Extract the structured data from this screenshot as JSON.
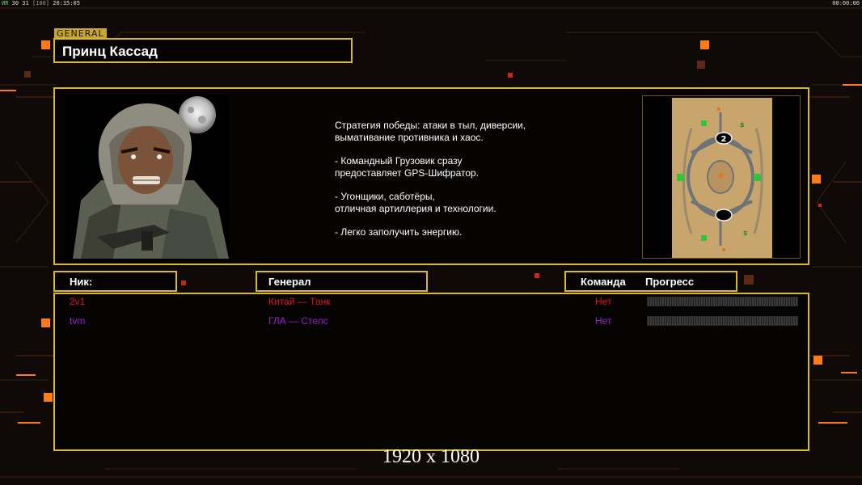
{
  "topbar": {
    "left_a": "ИR",
    "left_b": "30 31",
    "left_c": "[100]",
    "left_time": "20:35:05",
    "right_time": "00:00:00"
  },
  "general": {
    "tag": "GENERAL",
    "name": "Принц Кассад"
  },
  "description": {
    "p1": "Стратегия победы: атаки в тыл, диверсии,\n вымативание противника и хаос.",
    "p2": "- Командный Грузовик сразу\nпредоставляет GPS-Шифратор.",
    "p3": "- Угонщики, саботёры,\nотличная артиллерия и технологии.",
    "p4": "- Легко заполучить энергию."
  },
  "map": {
    "marker_2": "2",
    "supply_label": "$"
  },
  "columns": {
    "nick": "Ник:",
    "general": "Генерал",
    "team": "Команда",
    "progress": "Прогресс"
  },
  "players": [
    {
      "nick": "2v1",
      "general": "Китай — Танк",
      "team": "Нет",
      "color": "#e0141e"
    },
    {
      "nick": "tvm",
      "general": "ГЛА — Стелс",
      "team": "Нет",
      "color": "#9a1fd6"
    }
  ],
  "resolution": "1920 x 1080",
  "colors": {
    "accent_gold": "#d8b92a",
    "accent_orange": "#ff7a1a",
    "player_red": "#e0141e",
    "player_purple": "#9a1fd6"
  }
}
